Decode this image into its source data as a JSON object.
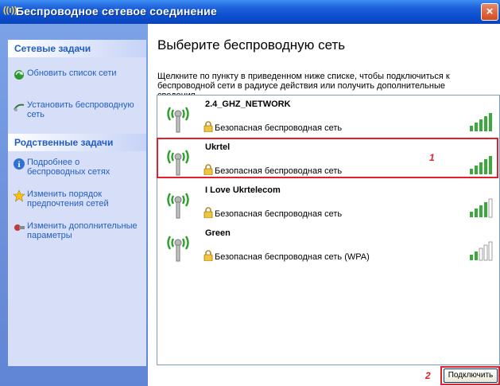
{
  "window": {
    "title": "Беспроводное сетевое соединение",
    "close_glyph": "×"
  },
  "sidebar": {
    "network_tasks": {
      "header": "Сетевые задачи",
      "items": [
        {
          "label": "Обновить список сети",
          "icon": "refresh-icon"
        },
        {
          "label": "Установить беспроводную сеть",
          "icon": "wizard-icon"
        }
      ]
    },
    "related_tasks": {
      "header": "Родственные задачи",
      "items": [
        {
          "label": "Подробнее о беспроводных сетях",
          "icon": "info-icon"
        },
        {
          "label": "Изменить порядок предпочтения сетей",
          "icon": "star-icon"
        },
        {
          "label": "Изменить дополнительные параметры",
          "icon": "settings-icon"
        }
      ]
    }
  },
  "main": {
    "heading": "Выберите беспроводную сеть",
    "description": "Щелкните по пункту в приведенном ниже списке, чтобы подключиться к беспроводной сети в радиусе действия или получить дополнительные сведения.",
    "networks": [
      {
        "name": "2.4_GHZ_NETWORK",
        "security": "Безопасная беспроводная сеть",
        "signal_bars": 5
      },
      {
        "name": "Ukrtel",
        "security": "Безопасная беспроводная сеть",
        "signal_bars": 5
      },
      {
        "name": "I Love Ukrtelecom",
        "security": "Безопасная беспроводная сеть",
        "signal_bars": 4
      },
      {
        "name": "Green",
        "security": "Безопасная беспроводная сеть (WPA)",
        "signal_bars": 2
      }
    ],
    "connect_button": "Подключить"
  },
  "annotations": {
    "marker_1": "1",
    "marker_2": "2",
    "color": "#e0202a"
  },
  "colors": {
    "title_bar": "#0a4ed0",
    "sidebar": "#6b8fd9",
    "task_link": "#215dc6"
  }
}
